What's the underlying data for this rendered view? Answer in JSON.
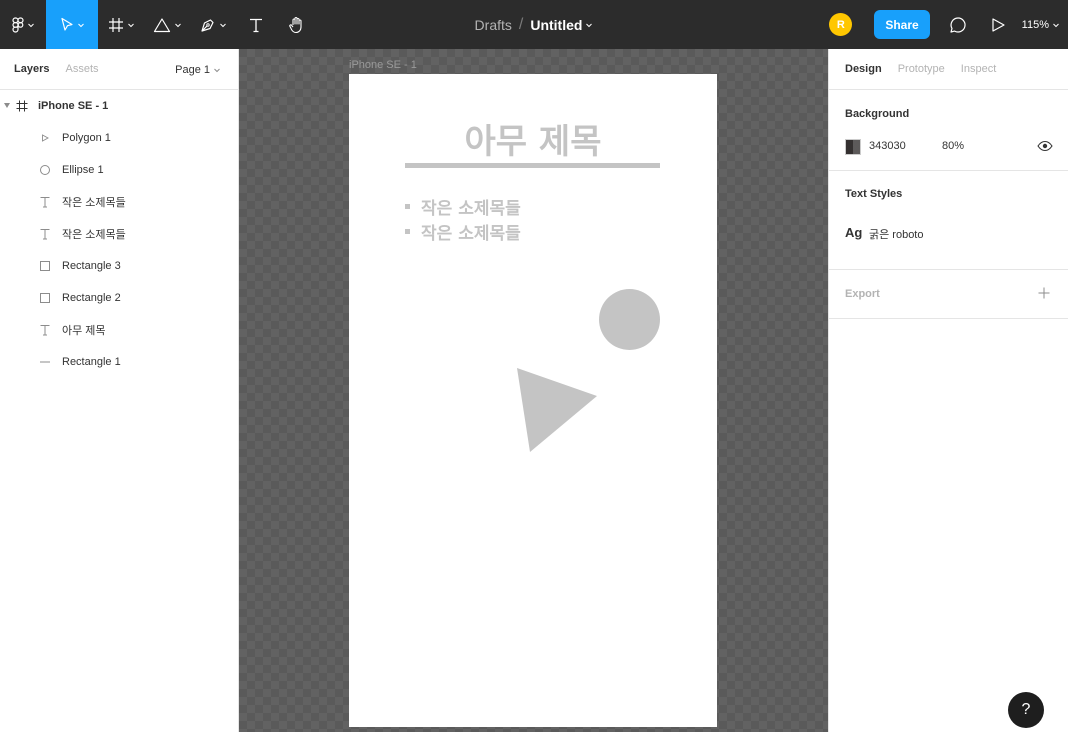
{
  "toolbar": {
    "breadcrumb_parent": "Drafts",
    "breadcrumb_separator": "/",
    "file_title": "Untitled",
    "avatar_initial": "R",
    "share_label": "Share",
    "zoom_label": "115%",
    "icons": [
      "figma-menu-icon",
      "move-tool-icon",
      "frame-tool-icon",
      "shape-tool-icon",
      "pen-tool-icon",
      "text-tool-icon",
      "hand-tool-icon",
      "comment-icon",
      "present-icon"
    ]
  },
  "left_panel": {
    "tab_layers": "Layers",
    "tab_assets": "Assets",
    "page_label": "Page 1",
    "layers": [
      {
        "name": "iPhone SE - 1",
        "icon": "frame-icon"
      },
      {
        "name": "Polygon 1",
        "icon": "polygon-icon"
      },
      {
        "name": "Ellipse 1",
        "icon": "ellipse-icon"
      },
      {
        "name": "작은 소제목들",
        "icon": "text-icon"
      },
      {
        "name": "작은 소제목들",
        "icon": "text-icon"
      },
      {
        "name": "Rectangle 3",
        "icon": "rectangle-icon"
      },
      {
        "name": "Rectangle 2",
        "icon": "rectangle-icon"
      },
      {
        "name": "아무 제목",
        "icon": "text-icon"
      },
      {
        "name": "Rectangle 1",
        "icon": "line-icon"
      }
    ]
  },
  "canvas": {
    "frame_label": "iPhone SE - 1",
    "title_text": "아무 제목",
    "list_items": [
      "작은 소제목들",
      "작은 소제목들"
    ],
    "shape_color": "#c4c4c4",
    "canvas_color": "#5a5a5a"
  },
  "right_panel": {
    "tab_design": "Design",
    "tab_prototype": "Prototype",
    "tab_inspect": "Inspect",
    "background_heading": "Background",
    "background_hex": "343030",
    "background_opacity": "80%",
    "text_styles_heading": "Text Styles",
    "text_style_sample": "Ag",
    "text_style_name": "굵은 roboto",
    "export_heading": "Export"
  },
  "help_label": "?",
  "colors": {
    "toolbar_bg": "#2c2c2c",
    "accent": "#18a0fb",
    "avatar": "#ffc700"
  }
}
